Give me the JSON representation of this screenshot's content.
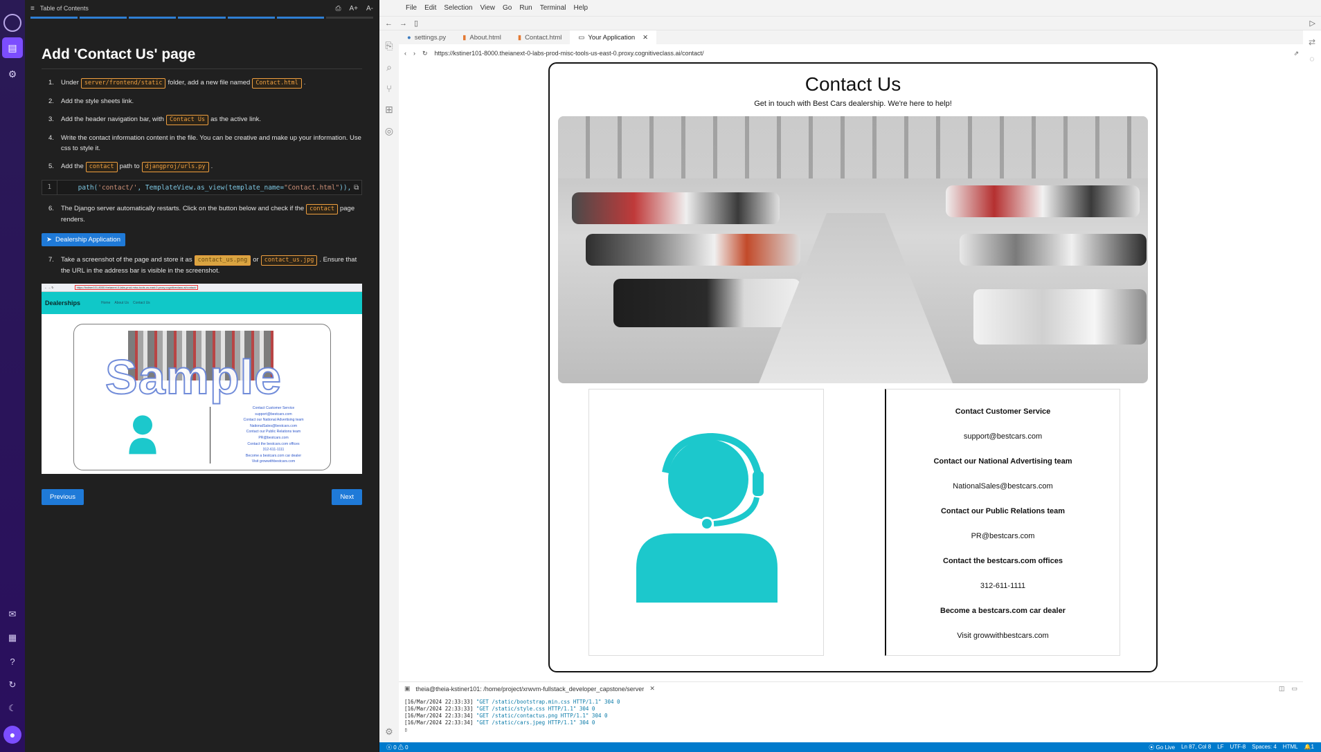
{
  "panel": {
    "header_title": "Table of Contents",
    "title": "Add 'Contact Us' page",
    "steps": [
      {
        "num": "1.",
        "t1": "Under",
        "c1": "server/frontend/static",
        "t2": "folder, add a new file named",
        "c2": "Contact.html",
        "t3": "."
      },
      {
        "num": "2.",
        "t1": "Add the style sheets link."
      },
      {
        "num": "3.",
        "t1": "Add the header navigation bar, with",
        "c1": "Contact Us",
        "t2": "as the active link."
      },
      {
        "num": "4.",
        "t1": "Write the contact information content in the file. You can be creative and make up your information. Use css to style it."
      },
      {
        "num": "5.",
        "t1": "Add the",
        "c1": "contact",
        "t2": "path to",
        "c2": "djangproj/urls.py",
        "t3": "."
      },
      {
        "num": "6.",
        "t1": "The Django server automatically restarts. Click on the button below and check if the",
        "c1": "contact",
        "t2": "page renders."
      },
      {
        "num": "7.",
        "t1": "Take a screenshot of the page and store it as",
        "c1": "contact_us.png",
        "t2": "or",
        "c2": "contact_us.jpg",
        "t3": ". Ensure that the URL in the address bar is visible in the screenshot."
      }
    ],
    "code": {
      "line_no": "1",
      "before": "path(",
      "s1": "'contact/'",
      "mid": ", TemplateView.as_view(template_name=",
      "s2": "\"Contact.html\"",
      "after": ")),"
    },
    "dealer_button": "Dealership Application",
    "sample": {
      "url": "https://kstiner101-8000.theianext-0-labs-prod-misc-tools-us-east-0.proxy.cognitiveclass.ai/contact/",
      "brand": "Dealerships",
      "nav_links": [
        "Home",
        "About Us",
        "Contact Us"
      ],
      "watermark": "Sample",
      "info_lines": [
        "Contact Customer Service",
        "support@bestcars.com",
        "Contact our National Advertising team",
        "NationalSales@bestcars.com",
        "Contact our Public Relations team",
        "PR@bestcars.com",
        "Contact the bestcars.com offices",
        "312-611-1111",
        "Become a bestcars.com car dealer",
        "Visit growwithbestcars.com"
      ]
    },
    "prev_button": "Previous",
    "next_button": "Next"
  },
  "ide": {
    "menu": [
      "File",
      "Edit",
      "Selection",
      "View",
      "Go",
      "Run",
      "Terminal",
      "Help"
    ],
    "tabs": [
      {
        "label": "settings.py",
        "type": "py"
      },
      {
        "label": "About.html",
        "type": "html"
      },
      {
        "label": "Contact.html",
        "type": "html"
      },
      {
        "label": "Your Application",
        "type": "preview"
      }
    ],
    "url": "https://kstiner101-8000.theianext-0-labs-prod-misc-tools-us-east-0.proxy.cognitiveclass.ai/contact/",
    "terminal_title": "theia@theia-kstiner101: /home/project/xrwvm-fullstack_developer_capstone/server",
    "terminal_lines": [
      {
        "ts": "[16/Mar/2024 22:33:33]",
        "req": "\"GET /static/bootstrap.min.css HTTP/1.1\" 304 0"
      },
      {
        "ts": "[16/Mar/2024 22:33:33]",
        "req": "\"GET /static/style.css HTTP/1.1\" 304 0"
      },
      {
        "ts": "[16/Mar/2024 22:33:34]",
        "req": "\"GET /static/contactus.png HTTP/1.1\" 304 0"
      },
      {
        "ts": "[16/Mar/2024 22:33:34]",
        "req": "\"GET /static/cars.jpeg HTTP/1.1\" 304 0"
      }
    ],
    "status": {
      "problems": "0 ⚠ 0",
      "golive": "Go Live",
      "position": "Ln 87, Col 8",
      "eol": "LF",
      "encoding": "UTF-8",
      "spaces": "Spaces: 4",
      "language": "HTML",
      "count": "1"
    }
  },
  "contact_page": {
    "title": "Contact Us",
    "subtitle": "Get in touch with Best Cars dealership. We're here to help!",
    "info_lines": [
      {
        "text": "Contact Customer Service",
        "bold": true
      },
      {
        "text": "support@bestcars.com",
        "bold": false
      },
      {
        "text": "Contact our National Advertising team",
        "bold": true
      },
      {
        "text": "NationalSales@bestcars.com",
        "bold": false
      },
      {
        "text": "Contact our Public Relations team",
        "bold": true
      },
      {
        "text": "PR@bestcars.com",
        "bold": false
      },
      {
        "text": "Contact the bestcars.com offices",
        "bold": true
      },
      {
        "text": "312-611-1111",
        "bold": false
      },
      {
        "text": "Become a bestcars.com car dealer",
        "bold": true
      },
      {
        "text": "Visit growwithbestcars.com",
        "bold": false
      }
    ],
    "icon_color": "#1cc8cc"
  }
}
